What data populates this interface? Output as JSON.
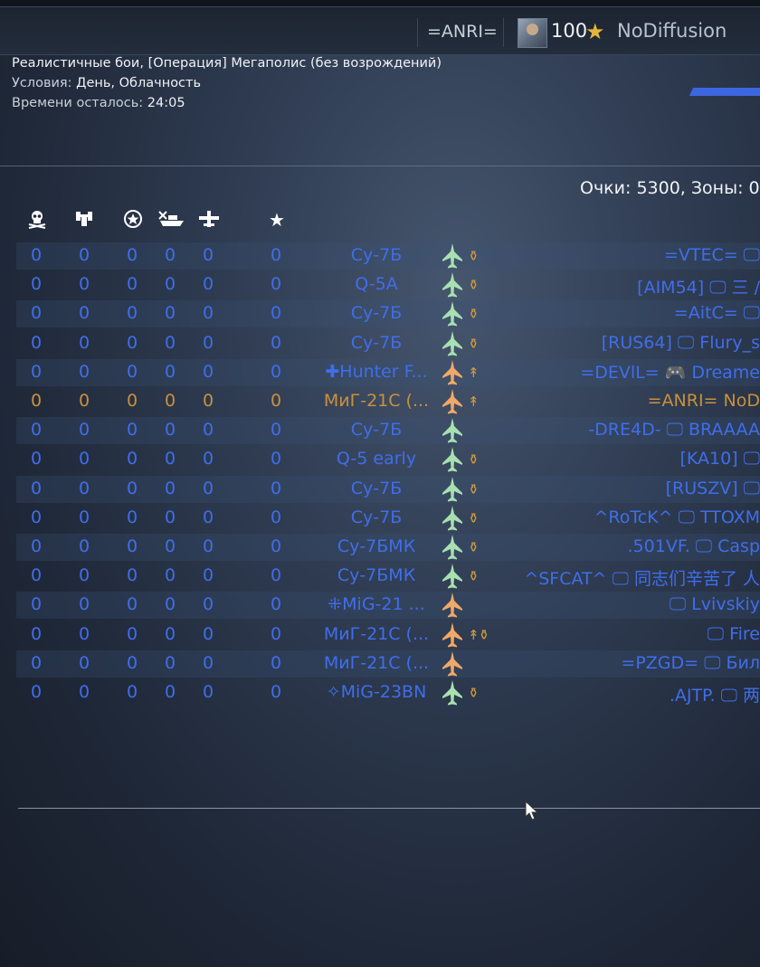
{
  "topbar": {
    "clan_tag": "=ANRI=",
    "player_level": "100",
    "player_name": "NoDiffusion"
  },
  "mission": {
    "title": "Реалистичные бои, [Операция] Мегаполис (без возрождений)",
    "conditions_label": "Условия:",
    "conditions_value": "День, Облачность",
    "time_label": "Времени осталось:",
    "time_value": "24:05"
  },
  "score": {
    "text": "Очки: 5300, Зоны: 0"
  },
  "columns": [
    "kills-icon",
    "ground-kills-icon",
    "assists-icon",
    "ship-kills-icon",
    "air-kills-icon",
    "score-star-icon"
  ],
  "rows": [
    {
      "stats": [
        "0",
        "0",
        "0",
        "0",
        "0",
        "0"
      ],
      "vehicle": "Су-7Б",
      "plane_color": "#a8e0b0",
      "ordnance": "⚱",
      "player": "=VTEC= 🖵",
      "self": false
    },
    {
      "stats": [
        "0",
        "0",
        "0",
        "0",
        "0",
        "0"
      ],
      "vehicle": "Q-5A",
      "plane_color": "#a8e0b0",
      "ordnance": "⚱",
      "player": "[AIM54] 🖵 三 /",
      "self": false
    },
    {
      "stats": [
        "0",
        "0",
        "0",
        "0",
        "0",
        "0"
      ],
      "vehicle": "Су-7Б",
      "plane_color": "#a8e0b0",
      "ordnance": "⚱",
      "player": "=AitC= 🖵",
      "self": false
    },
    {
      "stats": [
        "0",
        "0",
        "0",
        "0",
        "0",
        "0"
      ],
      "vehicle": "Су-7Б",
      "plane_color": "#a8e0b0",
      "ordnance": "⚱",
      "player": "[RUS64] 🖵 Flury_s",
      "self": false
    },
    {
      "stats": [
        "0",
        "0",
        "0",
        "0",
        "0",
        "0"
      ],
      "vehicle": "✚Hunter F...",
      "plane_color": "#f0a868",
      "ordnance": "↟",
      "player": "=DEVlL= 🎮 Dreame",
      "self": false
    },
    {
      "stats": [
        "0",
        "0",
        "0",
        "0",
        "0",
        "0"
      ],
      "vehicle": "МиГ-21С (...",
      "plane_color": "#f0a868",
      "ordnance": "↟",
      "player": "=ANRI= NoD",
      "self": true
    },
    {
      "stats": [
        "0",
        "0",
        "0",
        "0",
        "0",
        "0"
      ],
      "vehicle": "Су-7Б",
      "plane_color": "#a8e0b0",
      "ordnance": "",
      "player": "-DRE4D- 🖵 BRAAAA",
      "self": false
    },
    {
      "stats": [
        "0",
        "0",
        "0",
        "0",
        "0",
        "0"
      ],
      "vehicle": "Q-5 early",
      "plane_color": "#a8e0b0",
      "ordnance": "⚱",
      "player": "[KA10] 🖵",
      "self": false
    },
    {
      "stats": [
        "0",
        "0",
        "0",
        "0",
        "0",
        "0"
      ],
      "vehicle": "Су-7Б",
      "plane_color": "#a8e0b0",
      "ordnance": "⚱",
      "player": "[RUSZV] 🖵",
      "self": false
    },
    {
      "stats": [
        "0",
        "0",
        "0",
        "0",
        "0",
        "0"
      ],
      "vehicle": "Су-7Б",
      "plane_color": "#a8e0b0",
      "ordnance": "⚱",
      "player": "^RoTcK^ 🖵 TTOXM",
      "self": false
    },
    {
      "stats": [
        "0",
        "0",
        "0",
        "0",
        "0",
        "0"
      ],
      "vehicle": "Су-7БМК",
      "plane_color": "#a8e0b0",
      "ordnance": "⚱",
      "player": ".501VF. 🖵 Casp",
      "self": false
    },
    {
      "stats": [
        "0",
        "0",
        "0",
        "0",
        "0",
        "0"
      ],
      "vehicle": "Су-7БМК",
      "plane_color": "#a8e0b0",
      "ordnance": "⚱",
      "player": "^SFCAT^ 🖵 同志们辛苦了 人",
      "self": false
    },
    {
      "stats": [
        "0",
        "0",
        "0",
        "0",
        "0",
        "0"
      ],
      "vehicle": "⁜MiG-21 ...",
      "plane_color": "#f0a868",
      "ordnance": "",
      "player": "🖵 Lvivskiy",
      "self": false
    },
    {
      "stats": [
        "0",
        "0",
        "0",
        "0",
        "0",
        "0"
      ],
      "vehicle": "МиГ-21С (...",
      "plane_color": "#f0a868",
      "ordnance": "↟⚱",
      "player": "🖵 Fire",
      "self": false
    },
    {
      "stats": [
        "0",
        "0",
        "0",
        "0",
        "0",
        "0"
      ],
      "vehicle": "МиГ-21С (...",
      "plane_color": "#f0a868",
      "ordnance": "",
      "player": "=PZGD= 🖵 Бил",
      "self": false
    },
    {
      "stats": [
        "0",
        "0",
        "0",
        "0",
        "0",
        "0"
      ],
      "vehicle": "✧MiG-23BN",
      "plane_color": "#a8e0b0",
      "ordnance": "⚱",
      "player": ".AJTP. 🖵 两",
      "self": false
    }
  ],
  "colors": {
    "team_blue": "#3f6eea",
    "self_orange": "#c9903c",
    "ordnance": "#d29a3a",
    "plane_green": "#a8e0b0",
    "plane_orange": "#f0a868"
  }
}
